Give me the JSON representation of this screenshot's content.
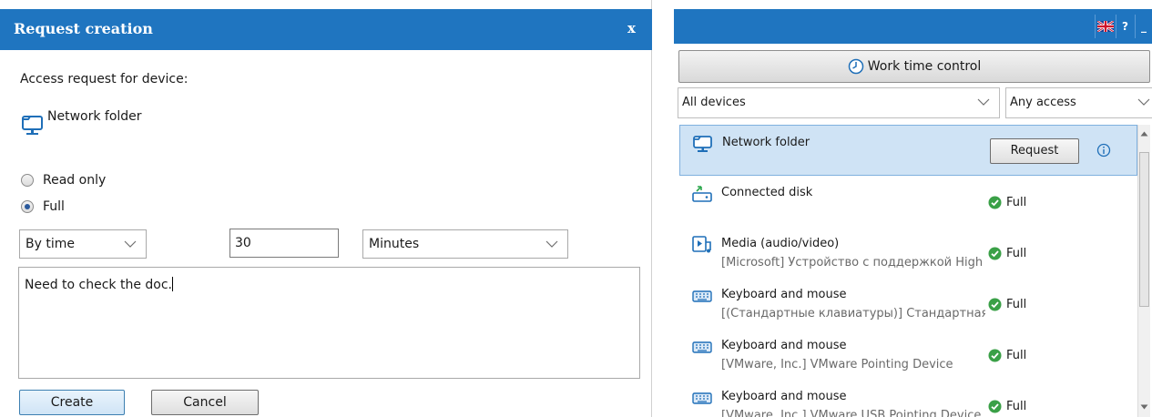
{
  "dialog": {
    "title": "Request creation",
    "close_label": "x",
    "access_label": "Access request for device:",
    "device_name": "Network folder",
    "radio_read_only": "Read only",
    "radio_full": "Full",
    "selected_access": "Full",
    "duration_mode": "By time",
    "duration_value": "30",
    "duration_unit": "Minutes",
    "comment": "Need to check the doc.",
    "create_label": "Create",
    "cancel_label": "Cancel"
  },
  "panel": {
    "header_buttons": {
      "help": "?",
      "minimize": "_"
    },
    "work_time_label": "Work time control",
    "filter_devices": "All devices",
    "filter_access": "Any access",
    "items": [
      {
        "title": "Network folder",
        "subtitle": "",
        "status": "",
        "action": "Request",
        "selected": true,
        "icon": "network-folder-icon"
      },
      {
        "title": "Connected disk",
        "subtitle": "",
        "status": "Full",
        "icon": "connected-disk-icon"
      },
      {
        "title": "Media (audio/video)",
        "subtitle": "[Microsoft] Устройство с поддержкой High Definition Audio",
        "status": "Full",
        "icon": "media-icon"
      },
      {
        "title": "Keyboard and mouse",
        "subtitle": "[(Стандартные клавиатуры)] Стандартная клавиатура",
        "status": "Full",
        "icon": "keyboard-icon"
      },
      {
        "title": "Keyboard and mouse",
        "subtitle": "[VMware, Inc.] VMware Pointing Device",
        "status": "Full",
        "icon": "keyboard-icon"
      },
      {
        "title": "Keyboard and mouse",
        "subtitle": "[VMware, Inc.] VMware USB Pointing Device",
        "status": "Full",
        "icon": "keyboard-icon"
      }
    ]
  },
  "colors": {
    "header_blue": "#1f75c0",
    "selection": "#cfe3f5",
    "status_green": "#3aa047"
  }
}
